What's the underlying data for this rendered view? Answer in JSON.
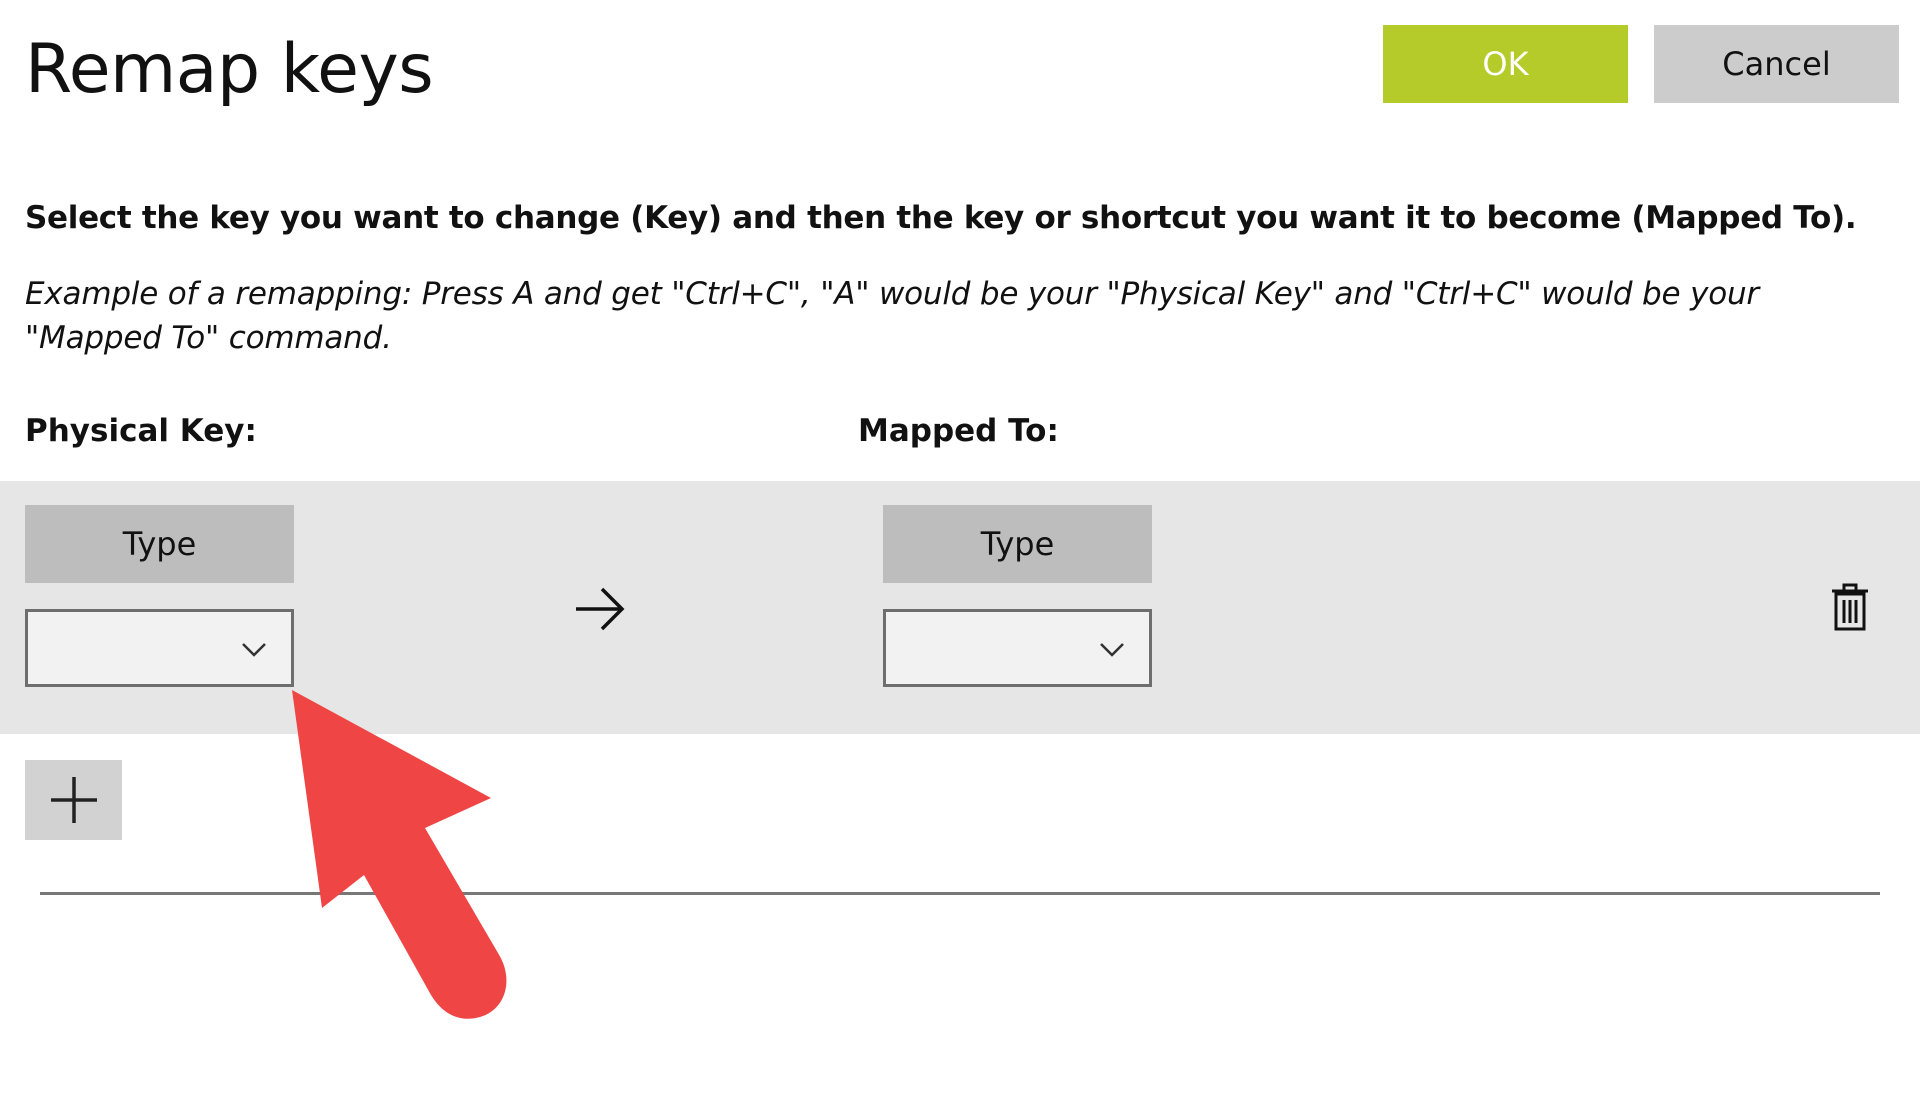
{
  "header": {
    "title": "Remap keys",
    "ok_label": "OK",
    "cancel_label": "Cancel"
  },
  "body": {
    "instruction": "Select the key you want to change (Key) and then the key or shortcut you want it to become (Mapped To).",
    "example": "Example of a remapping: Press A and get \"Ctrl+C\", \"A\" would be your \"Physical Key\" and \"Ctrl+C\" would be your \"Mapped To\" command."
  },
  "columns": {
    "physical_label": "Physical Key:",
    "mapped_label": "Mapped To:"
  },
  "row": {
    "physical": {
      "type_label": "Type",
      "selected_value": ""
    },
    "mapped": {
      "type_label": "Type",
      "selected_value": ""
    }
  },
  "icons": {
    "arrow": "arrow-right-icon",
    "delete": "trash-icon",
    "add": "plus-icon",
    "chevron": "chevron-down-icon",
    "overlay": "red-pointer-arrow"
  },
  "colors": {
    "ok": "#b4cb2a",
    "cancel": "#cccccc",
    "row_bg": "#e6e6e6",
    "type_button": "#bdbdbd",
    "annotation_arrow": "#f04545"
  }
}
